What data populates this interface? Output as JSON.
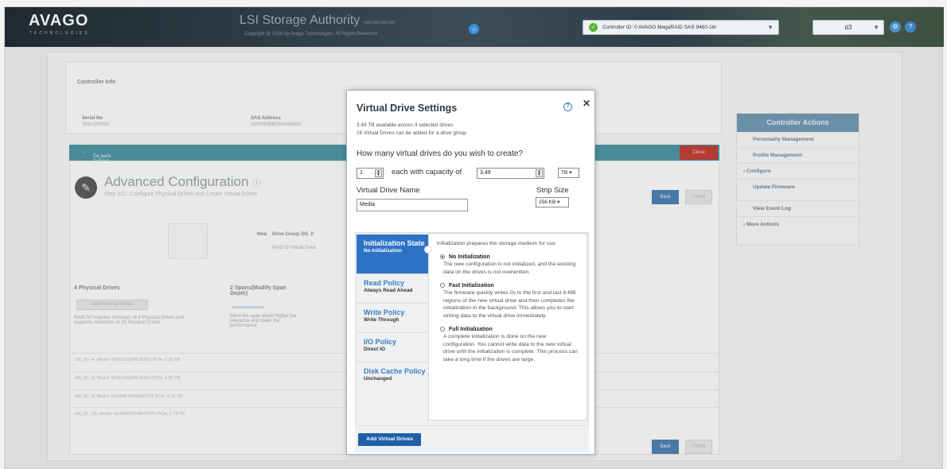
{
  "header": {
    "logo": "AVAGO",
    "logo_sub": "TECHNOLOGIES",
    "title": "LSI Storage Authority",
    "version": "v005.050.000.000",
    "copyright": "Copyright @ 2016 by Avago Technologies. All Rights Reserved",
    "controller_select": "Controller ID: 0 AVAGO MegaRAID SAS 9460-16i",
    "user": "d3"
  },
  "background": {
    "controller_info_title": "Controller Info",
    "serial_label": "Serial No",
    "serial_value": "SP61000005",
    "sas_label": "SAS Address",
    "sas_value": "0x500605B0004254500",
    "back_link": "Go back to Drive Group, Drives and Other Hardware list",
    "close": "Close",
    "adv_title": "Advanced Configuration",
    "adv_sub": "Step 2/2 : Configure Physical Drives and Create Virtual Drives",
    "back": "Back",
    "finish": "Finish",
    "new_label": "New",
    "drive_group": "Drive Group DG_0",
    "drive_group_sub": "RAID 0/ Virtual Drive",
    "physical_drives": "4 Physical Drives",
    "add_physical": "Add Physical Drives",
    "pd_note": "RAID 50 requires minimum of 4 Physical Drives and supports maximum of 16 Physical Drives",
    "spans": "2 Spans(Modify Span Depth)",
    "span_note": "More the span depth higher the tolerance and lower the performance",
    "drive_rows": [
      "EN_00 : 4, Model: INTELSSDPE2KX02 PCIe, 1.82 TB",
      "EN_00 : 8, Model: INTELSSDPE2KX02 PCIe, 1.82 TB",
      "EN_00 : 8, Model: HUSMR7616BDP3Y1 PCIe, 1.75 TB",
      "EN_00 : 10, Model: HUSMR7616BDP3Y1 PCIe, 1.75 TB"
    ]
  },
  "actions": {
    "title": "Controller Actions",
    "items": [
      "Personality Management",
      "Profile Management",
      "Configure",
      "Update Firmware",
      "View Event Log",
      "More Actions"
    ]
  },
  "modal": {
    "title": "Virtual Drive Settings",
    "info1": "3.49 TB available across 4 selected drives",
    "info2": "16 Virtual Drives can be added for a drive group",
    "question": "How many virtual drives do you wish to create?",
    "count": "1",
    "each_with": "each with capacity of",
    "capacity": "3.49",
    "unit": "TB",
    "vd_name_label": "Virtual Drive Name",
    "vd_name": "Media",
    "strip_label": "Strip Size",
    "strip_value": "256 KB",
    "tabs": [
      {
        "name": "Initialization State",
        "value": "No Initialization"
      },
      {
        "name": "Read Policy",
        "value": "Always Read Ahead"
      },
      {
        "name": "Write Policy",
        "value": "Write Through"
      },
      {
        "name": "I/O Policy",
        "value": "Direct IO"
      },
      {
        "name": "Disk Cache Policy",
        "value": "Unchanged"
      }
    ],
    "pane_intro": "Initialization prepares the storage medium for use",
    "options": [
      {
        "title": "No Initialization",
        "desc": "The new configuration is not initialized, and the existing data on the drives is not overwritten.",
        "selected": true
      },
      {
        "title": "Fast Initialization",
        "desc": "The firmware quickly writes 0s to the first and last 8-MB regions of the new virtual drive and then completes the initialization in the background. This allows you to start writing data to the virtual drive immediately.",
        "selected": false
      },
      {
        "title": "Full Initialization",
        "desc": "A complete initialization is done on the new configuration. You cannot write data to the new virtual drive until the initialization is complete. This process can take a long time if the drives are large.",
        "selected": false
      }
    ],
    "add_button": "Add Virtual Drives"
  }
}
